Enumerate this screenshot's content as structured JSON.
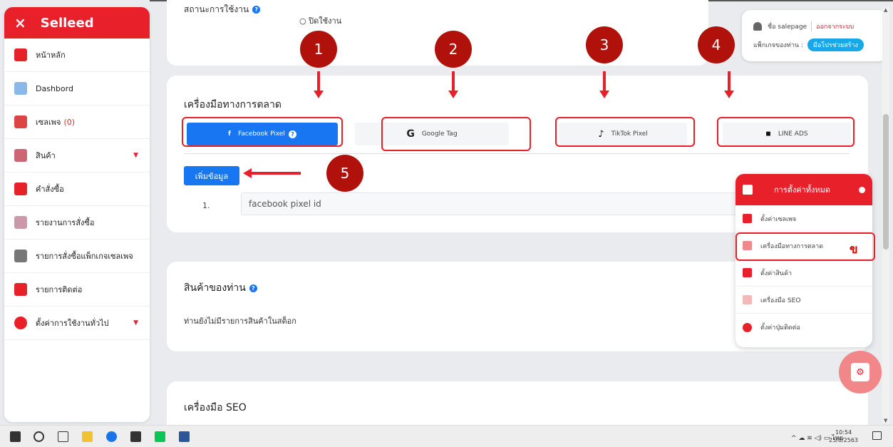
{
  "sidebar": {
    "close_icon": "×",
    "brand": "Selleed",
    "items": [
      {
        "label": "หน้าหลัก",
        "icon": "home-icon",
        "color": "#e8202a"
      },
      {
        "label": "Dashbord",
        "icon": "dashboard-icon",
        "color": "#8bb8e8"
      },
      {
        "label": "เซลเพจ",
        "count": "(0)",
        "icon": "salepage-icon",
        "color": "#d44"
      },
      {
        "label": "สินค้า",
        "icon": "product-icon",
        "color": "#c67"
      },
      {
        "label": "คำสั่งซื้อ",
        "icon": "order-icon",
        "color": "#e8202a"
      },
      {
        "label": "รายงานการสั่งซื้อ",
        "icon": "report-icon",
        "color": "#c9a"
      },
      {
        "label": "รายการสั่งซื้อแพ็กเกจเซลเพจ",
        "icon": "package-order-icon",
        "color": "#777"
      },
      {
        "label": "รายการติดต่อ",
        "icon": "contact-icon",
        "color": "#e8202a"
      },
      {
        "label": "ตั้งค่าการใช้งานทั่วไป",
        "icon": "settings-icon",
        "color": "#e8202a"
      }
    ]
  },
  "status": {
    "label": "สถานะการใช้งาน",
    "radio_option": "ปิดใช้งาน"
  },
  "marketing": {
    "title": "เครื่องมือทางการตลาด",
    "tabs": [
      {
        "label": "Facebook Pixel",
        "glyph": "f",
        "active": true
      },
      {
        "label": "Google Tag",
        "glyph": "G",
        "active": false
      },
      {
        "label": "TikTok Pixel",
        "glyph": "♪",
        "active": false
      },
      {
        "label": "LINE ADS",
        "glyph": "◼",
        "active": false
      }
    ],
    "add_button": "เพิ่มข้อมูล",
    "row_number": "1.",
    "pixel_placeholder": "facebook pixel id"
  },
  "products": {
    "title": "สินค้าของท่าน",
    "empty": "ท่านยังไม่มีรายการสินค้าในสต็อก"
  },
  "seo": {
    "title": "เครื่องมือ SEO"
  },
  "user": {
    "name_label": "ชื่อ salepage",
    "logout": "ออกจากระบบ",
    "package_label": "แพ็กเกจของท่าน :",
    "package_badge": "มือโปรช่วยสร้าง"
  },
  "settings_panel": {
    "title": "การตั้งค่าทั้งหมด",
    "items": [
      {
        "label": "ตั้งค่าเซลเพจ"
      },
      {
        "label": "เครื่องมือทางการตลาด"
      },
      {
        "label": "ตั้งค่าสินค้า"
      },
      {
        "label": "เครื่องมือ SEO"
      },
      {
        "label": "ตั้งค่าปุ่มติดต่อ"
      }
    ]
  },
  "annotations": {
    "numbers": [
      "1",
      "2",
      "3",
      "4",
      "5"
    ],
    "mark": "ข"
  },
  "taskbar": {
    "time": "10:54",
    "date": "25/8/2563",
    "lang": "ไทย"
  },
  "colors": {
    "brand_red": "#e8202a",
    "primary_blue": "#1976f2",
    "badge_cyan": "#16a8e8",
    "annotation_dark_red": "#b0120b"
  }
}
